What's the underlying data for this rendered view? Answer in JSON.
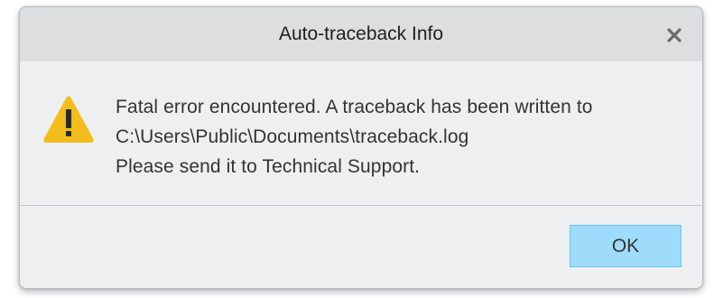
{
  "dialog": {
    "title": "Auto-traceback Info",
    "close_icon": "close-icon",
    "warning_icon": "warning-icon",
    "message_lines": [
      "Fatal error encountered. A traceback has been written to",
      "C:\\Users\\Public\\Documents\\traceback.log",
      "Please send it to Technical Support."
    ],
    "ok_label": "OK"
  },
  "colors": {
    "ok_button_bg": "#9fdcfb",
    "ok_button_border": "#6cc4f0",
    "warning_yellow": "#f3bd1c",
    "titlebar_bg": "#dcdee0",
    "body_bg": "#eeeff1"
  }
}
